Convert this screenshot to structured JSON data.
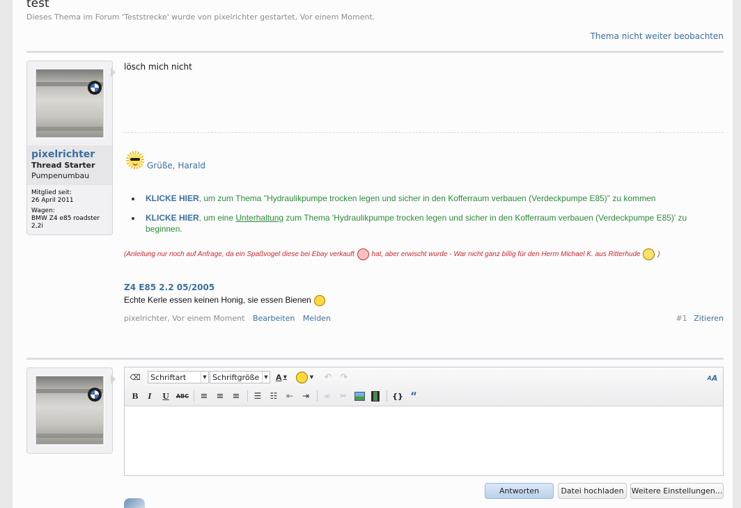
{
  "thread": {
    "title": "test",
    "subtitle": "Dieses Thema im Forum 'Teststrecke' wurde von pixelrichter gestartet, Vor einem Moment.",
    "unwatch_label": "Thema nicht weiter beobachten"
  },
  "post": {
    "username": "pixelrichter",
    "user_title": "Thread Starter",
    "user_banner": "Pumpenumbau",
    "member_since_label": "Mitglied seit:",
    "member_since": "26 April 2011",
    "car_label": "Wagen:",
    "car_line1": "BMW Z4 e85 roadster",
    "car_line2": "2,2i",
    "message": "lösch mich nicht",
    "greeting": "Grüße, Harald",
    "bullet1_link": "KLICKE HIER",
    "bullet1_text": ", um zum Thema \"Hydraulikpumpe trocken legen und sicher in den Kofferraum verbauen (Verdeckpumpe E85)\" zu kommen",
    "bullet2_link": "KLICKE HIER",
    "bullet2_pre": ", um eine ",
    "bullet2_underline": "Unterhaltung",
    "bullet2_text": " zum Thema 'Hydraulikpumpe trocken legen und sicher in den Kofferraum verbauen (Verdeckpumpe E85)' zu beginnen.",
    "notice_part1": "(Anleitung nur noch auf Anfrage, da ein Spaßvogel diese bei Ebay verkauft",
    "notice_part2": "hat, aber erwischt wurde - War nicht ganz billig für den Herrn Michael K. aus Ritterhude",
    "notice_end": ")",
    "sig_title": "Z4 E85 2.2 05/2005",
    "sig_text": "Echte Kerle essen keinen Honig, sie essen Bienen",
    "meta_author": "pixelrichter",
    "meta_time": "Vor einem Moment",
    "edit_label": "Bearbeiten",
    "report_label": "Melden",
    "post_number": "#1",
    "quote_label": "Zitieren"
  },
  "editor": {
    "font_select": "Schriftart",
    "size_select": "Schriftgröße",
    "reply_button": "Antworten",
    "upload_button": "Datei hochladen",
    "more_button": "Weitere Einstellungen..."
  },
  "colors": {
    "link": "#3b6fa0",
    "green_text": "#2c8a3a",
    "notice_red": "#cc2a2a"
  }
}
